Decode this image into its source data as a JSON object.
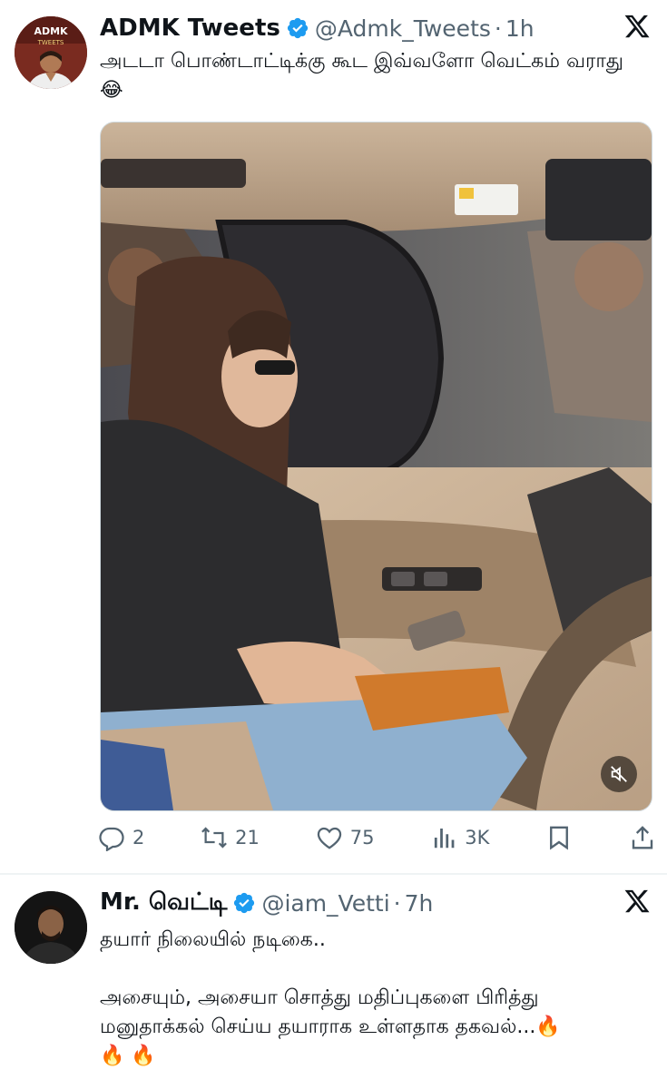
{
  "tweets": [
    {
      "display_name": "ADMK Tweets",
      "handle": "@Admk_Tweets",
      "separator": "·",
      "time": "1h",
      "text": "அடடா பொண்டாட்டிக்கு கூட இவ்வளோ வெட்கம் வராது😂",
      "avatar_text": "ADMK TWEETS",
      "stats": {
        "replies": "2",
        "reposts": "21",
        "likes": "75",
        "views": "3K"
      }
    },
    {
      "display_name": "Mr. வெட்டி",
      "handle": "@iam_Vetti",
      "separator": "·",
      "time": "7h",
      "text": "தயார் நிலையில் நடிகை..\n\nஅசையும், அசையா சொத்து மதிப்புகளை பிரித்து மனுதாக்கல் செய்ய தயாராக உள்ளதாக தகவல்...🔥\n🔥 🔥"
    }
  ],
  "icons": {
    "verified": "verified-badge-icon",
    "x_logo": "x-logo-icon",
    "reply": "reply-icon",
    "repost": "repost-icon",
    "like": "heart-icon",
    "views": "views-icon",
    "bookmark": "bookmark-icon",
    "share": "share-icon",
    "mute": "mute-icon"
  },
  "colors": {
    "verified": "#1d9bf0",
    "text": "#0f1419",
    "muted": "#536471",
    "divider": "#eff3f4"
  }
}
